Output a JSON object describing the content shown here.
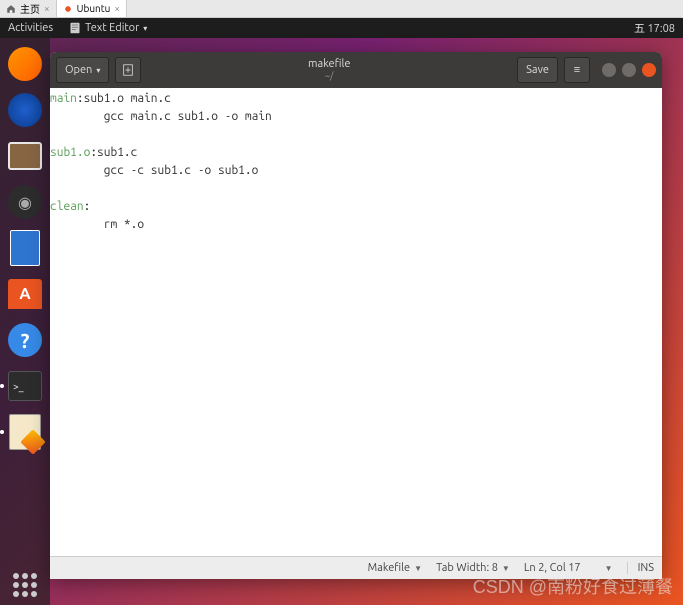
{
  "browser_tabs": [
    {
      "label": "主页",
      "icon": "home"
    },
    {
      "label": "Ubuntu",
      "icon": "ubuntu"
    }
  ],
  "ubuntu_top": {
    "activities": "Activities",
    "app": "Text Editor",
    "clock": "五 17:08"
  },
  "editor": {
    "open_label": "Open",
    "save_label": "Save",
    "title": "makefile",
    "subtitle": "~/",
    "code": {
      "l1_target": "main",
      "l1_rest": ":sub1.o main.c",
      "l2": "        gcc main.c sub1.o -o main",
      "l3_target": "sub1.o",
      "l3_rest": ":sub1.c",
      "l4": "        gcc -c sub1.c -o sub1.o",
      "l5_target": "clean",
      "l5_rest": ":",
      "l6": "        rm *.o"
    },
    "status": {
      "lang": "Makefile",
      "tab": "Tab Width: 8",
      "pos": "Ln 2, Col 17",
      "mode": "INS"
    }
  },
  "watermark": "CSDN @南粉好食过薄餐"
}
